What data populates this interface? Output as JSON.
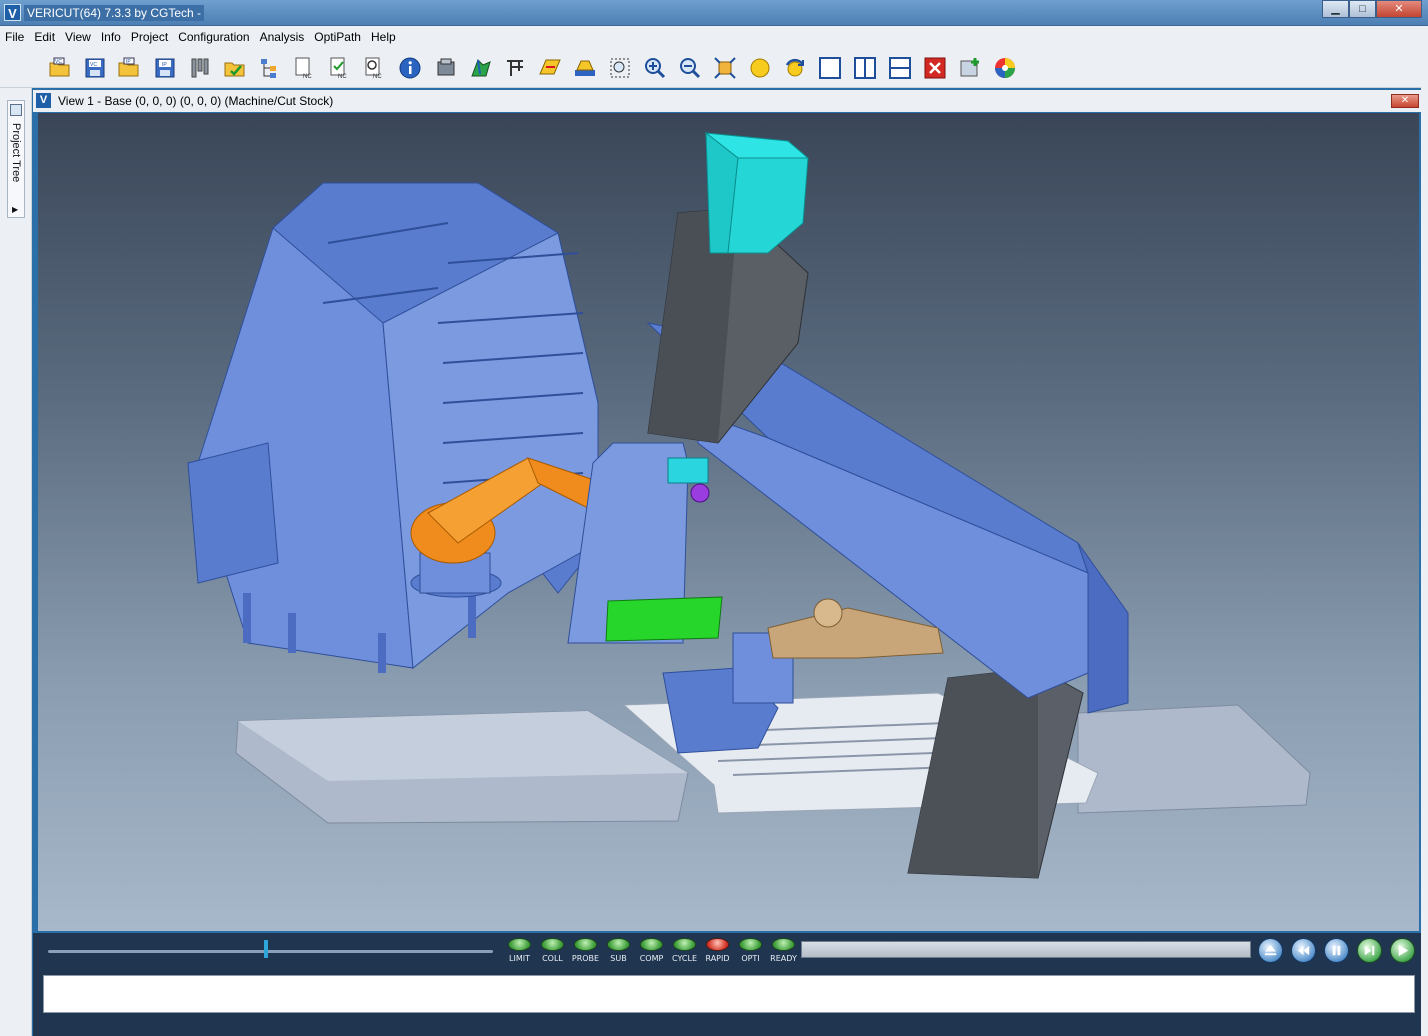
{
  "window": {
    "title": "VERICUT(64)  7.3.3 by CGTech -",
    "minimize_label": "▁",
    "maximize_label": "□",
    "close_label": "✕"
  },
  "menu": {
    "items": [
      "File",
      "Edit",
      "View",
      "Info",
      "Project",
      "Configuration",
      "Analysis",
      "OptiPath",
      "Help"
    ]
  },
  "toolbar": {
    "icons": [
      "open-project-icon",
      "save-project-icon",
      "open-ip-icon",
      "save-ip-icon",
      "tool-manager-icon",
      "open-folder-check-icon",
      "component-tree-icon",
      "nc-program-icon",
      "nc-check-icon",
      "nc-review-icon",
      "info-icon",
      "machine-settings-icon",
      "cut-stock-icon",
      "fixture-icon",
      "layout-icon",
      "model-icon",
      "zoom-box-icon",
      "zoom-in-icon",
      "zoom-out-icon",
      "fit-view-icon",
      "light-icon",
      "rotate-icon",
      "single-view-icon",
      "split-vertical-icon",
      "split-horizontal-icon",
      "close-view-icon",
      "add-view-icon",
      "color-wheel-icon"
    ]
  },
  "side_panel": {
    "tab_label": "Project Tree"
  },
  "view": {
    "title": "View 1 - Base (0, 0, 0) (0, 0, 0) (Machine/Cut Stock)",
    "close_label": "✕",
    "colors": {
      "enclosure": "#6f8fdc",
      "column": "#5a5f66",
      "spindle": "#25d6d6",
      "robot": "#f08c1d",
      "fixture": "#27d62a",
      "workpiece": "#c8a679",
      "base": "#b8c4d6"
    }
  },
  "controls": {
    "slider_position": 0.49,
    "progress_fraction": 0,
    "leds": [
      {
        "label": "LIMIT",
        "state": "green"
      },
      {
        "label": "COLL",
        "state": "green"
      },
      {
        "label": "PROBE",
        "state": "green"
      },
      {
        "label": "SUB",
        "state": "green"
      },
      {
        "label": "COMP",
        "state": "green"
      },
      {
        "label": "CYCLE",
        "state": "green"
      },
      {
        "label": "RAPID",
        "state": "red"
      },
      {
        "label": "OPTI",
        "state": "green"
      },
      {
        "label": "READY",
        "state": "green"
      }
    ],
    "buttons": [
      "reset-icon",
      "rewind-icon",
      "pause-icon",
      "step-icon",
      "play-icon"
    ]
  },
  "log": {
    "text": ""
  }
}
